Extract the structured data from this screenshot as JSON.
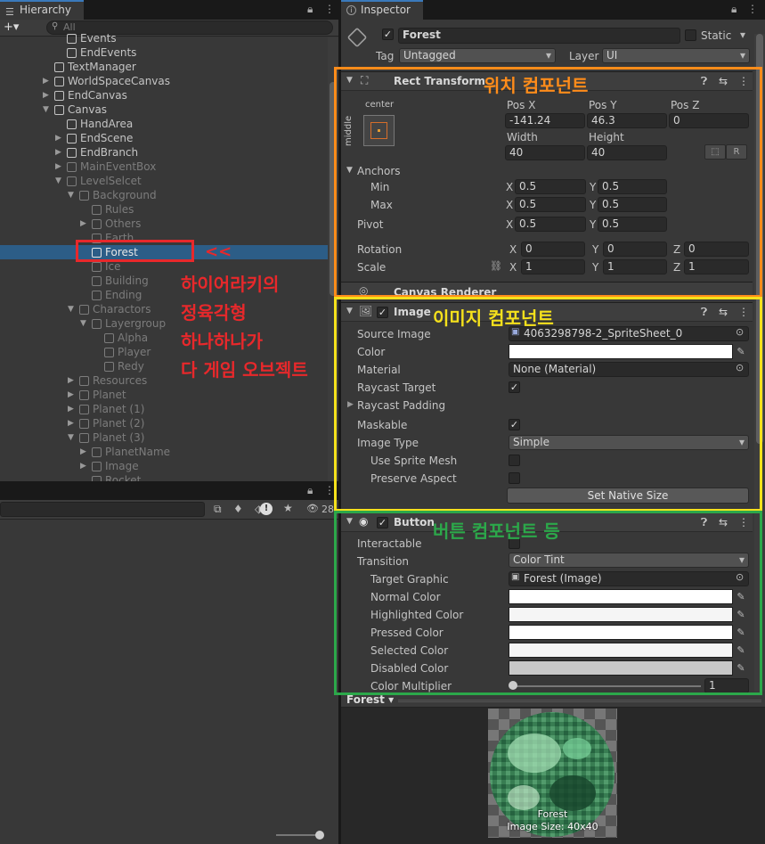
{
  "hierarchy": {
    "tab": "Hierarchy",
    "search_placeholder": "All",
    "add_label": "+▾",
    "rows": [
      {
        "label": "Events",
        "depth": 2,
        "dim": false,
        "arrow": ""
      },
      {
        "label": "EndEvents",
        "depth": 2,
        "dim": false,
        "arrow": ""
      },
      {
        "label": "TextManager",
        "depth": 1,
        "dim": false,
        "arrow": ""
      },
      {
        "label": "WorldSpaceCanvas",
        "depth": 1,
        "dim": false,
        "arrow": "▶"
      },
      {
        "label": "EndCanvas",
        "depth": 1,
        "dim": false,
        "arrow": "▶"
      },
      {
        "label": "Canvas",
        "depth": 1,
        "dim": false,
        "arrow": "▼"
      },
      {
        "label": "HandArea",
        "depth": 2,
        "dim": false,
        "arrow": ""
      },
      {
        "label": "EndScene",
        "depth": 2,
        "dim": false,
        "arrow": "▶"
      },
      {
        "label": "EndBranch",
        "depth": 2,
        "dim": false,
        "arrow": "▶"
      },
      {
        "label": "MainEventBox",
        "depth": 2,
        "dim": true,
        "arrow": "▶"
      },
      {
        "label": "LevelSelcet",
        "depth": 2,
        "dim": true,
        "arrow": "▼"
      },
      {
        "label": "Background",
        "depth": 3,
        "dim": true,
        "arrow": "▼"
      },
      {
        "label": "Rules",
        "depth": 4,
        "dim": true,
        "arrow": ""
      },
      {
        "label": "Others",
        "depth": 4,
        "dim": true,
        "arrow": "▶"
      },
      {
        "label": "Earth",
        "depth": 4,
        "dim": true,
        "arrow": ""
      },
      {
        "label": "Forest",
        "depth": 4,
        "dim": false,
        "arrow": "",
        "selected": true
      },
      {
        "label": "Ice",
        "depth": 4,
        "dim": true,
        "arrow": ""
      },
      {
        "label": "Building",
        "depth": 4,
        "dim": true,
        "arrow": ""
      },
      {
        "label": "Ending",
        "depth": 4,
        "dim": true,
        "arrow": ""
      },
      {
        "label": "Charactors",
        "depth": 3,
        "dim": true,
        "arrow": "▼"
      },
      {
        "label": "Layergroup",
        "depth": 4,
        "dim": true,
        "arrow": "▼"
      },
      {
        "label": "Alpha",
        "depth": 5,
        "dim": true,
        "arrow": ""
      },
      {
        "label": "Player",
        "depth": 5,
        "dim": true,
        "arrow": ""
      },
      {
        "label": "Redy",
        "depth": 5,
        "dim": true,
        "arrow": ""
      },
      {
        "label": "Resources",
        "depth": 3,
        "dim": true,
        "arrow": "▶"
      },
      {
        "label": "Planet",
        "depth": 3,
        "dim": true,
        "arrow": "▶"
      },
      {
        "label": "Planet (1)",
        "depth": 3,
        "dim": true,
        "arrow": "▶"
      },
      {
        "label": "Planet (2)",
        "depth": 3,
        "dim": true,
        "arrow": "▶"
      },
      {
        "label": "Planet (3)",
        "depth": 3,
        "dim": true,
        "arrow": "▼"
      },
      {
        "label": "PlanetName",
        "depth": 4,
        "dim": true,
        "arrow": "▶"
      },
      {
        "label": "Image",
        "depth": 4,
        "dim": true,
        "arrow": "▶"
      },
      {
        "label": "Rocket",
        "depth": 4,
        "dim": true,
        "arrow": ""
      }
    ]
  },
  "bottom_panel": {
    "hidden_count": "28"
  },
  "annotations": {
    "arrow": "<<",
    "hierarchy_note": [
      "하이어라키의",
      "정육각형",
      "하나하나가",
      "다 게임 오브젝트"
    ],
    "rect_note": "위치 컴포넌트",
    "image_note": "이미지 컴포넌트",
    "button_note": "버튼 컴포넌트 등",
    "colors": {
      "red": "#e8282b",
      "orange": "#ff8c1a",
      "yellow": "#f5e11c",
      "green": "#2ca84a"
    }
  },
  "inspector": {
    "tab": "Inspector",
    "object_name": "Forest",
    "static_label": "Static",
    "tag_label": "Tag",
    "tag_value": "Untagged",
    "layer_label": "Layer",
    "layer_value": "UI",
    "rect_transform": {
      "title": "Rect Transform",
      "anchor_h": "center",
      "anchor_v": "middle",
      "pos_x_label": "Pos X",
      "pos_y_label": "Pos Y",
      "pos_z_label": "Pos Z",
      "pos_x": "-141.24",
      "pos_y": "46.3",
      "pos_z": "0",
      "width_label": "Width",
      "height_label": "Height",
      "width": "40",
      "height": "40",
      "r_btn": "R",
      "anchors_label": "Anchors",
      "min_label": "Min",
      "max_label": "Max",
      "pivot_label": "Pivot",
      "min_x": "0.5",
      "min_y": "0.5",
      "max_x": "0.5",
      "max_y": "0.5",
      "pivot_x": "0.5",
      "pivot_y": "0.5",
      "rotation_label": "Rotation",
      "scale_label": "Scale",
      "rot_x": "0",
      "rot_y": "0",
      "rot_z": "0",
      "scale_x": "1",
      "scale_y": "1",
      "scale_z": "1",
      "x": "X",
      "y": "Y",
      "z": "Z"
    },
    "canvas_renderer_title": "Canvas Renderer",
    "image": {
      "title": "Image",
      "source_image_label": "Source Image",
      "source_image": "4063298798-2_SpriteSheet_0",
      "color_label": "Color",
      "material_label": "Material",
      "material": "None (Material)",
      "raycast_target_label": "Raycast Target",
      "raycast_padding_label": "Raycast Padding",
      "maskable_label": "Maskable",
      "image_type_label": "Image Type",
      "image_type": "Simple",
      "use_sprite_mesh_label": "Use Sprite Mesh",
      "preserve_aspect_label": "Preserve Aspect",
      "set_native_size": "Set Native Size"
    },
    "button": {
      "title": "Button",
      "interactable_label": "Interactable",
      "transition_label": "Transition",
      "transition": "Color Tint",
      "target_graphic_label": "Target Graphic",
      "target_graphic": "Forest (Image)",
      "normal_label": "Normal Color",
      "highlighted_label": "Highlighted Color",
      "pressed_label": "Pressed Color",
      "selected_label": "Selected Color",
      "disabled_label": "Disabled Color",
      "multiplier_label": "Color Multiplier",
      "multiplier": "1",
      "colors": {
        "normal": "#ffffff",
        "highlighted": "#f5f5f5",
        "pressed": "#c8c8c8",
        "selected": "#f5f5f5",
        "disabled": "#c8c8c8"
      }
    },
    "preview": {
      "name": "Forest",
      "caption_name": "Forest",
      "caption_size": "Image Size: 40x40"
    }
  }
}
